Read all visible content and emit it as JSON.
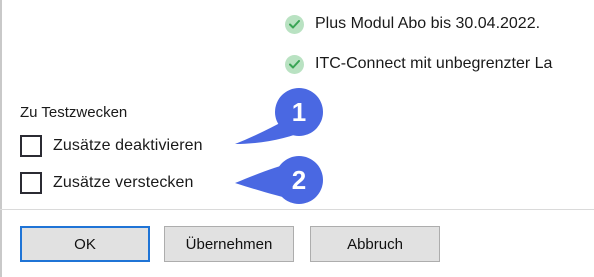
{
  "features": [
    {
      "icon": "check-circle-icon",
      "text": "Plus Modul Abo bis 30.04.2022."
    },
    {
      "icon": "check-circle-icon",
      "text": "ITC-Connect mit unbegrenzter La"
    }
  ],
  "test_group": {
    "label": "Zu Testzwecken",
    "checkboxes": [
      {
        "label": "Zusätze deaktivieren",
        "checked": false
      },
      {
        "label": "Zusätze verstecken",
        "checked": false
      }
    ]
  },
  "callouts": [
    "1",
    "2"
  ],
  "buttons": {
    "ok": "OK",
    "apply": "Übernehmen",
    "cancel": "Abbruch"
  },
  "colors": {
    "callout": "#4a68e2",
    "check": "#3aa455",
    "default_border": "#1f74d6"
  }
}
